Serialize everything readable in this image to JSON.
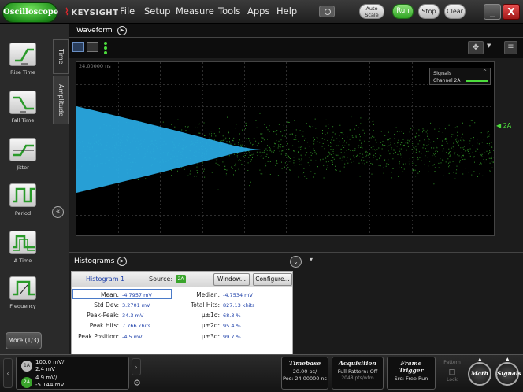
{
  "app": {
    "mode_button": "Oscilloscope",
    "brand": "KEYSIGHT"
  },
  "menu": [
    "File",
    "Setup",
    "Measure",
    "Tools",
    "Apps",
    "Help"
  ],
  "toolbar": {
    "auto_scale": "Auto Scale",
    "run": "Run",
    "stop": "Stop",
    "clear": "Clear",
    "minimize": "_",
    "close": "X"
  },
  "left_panel": {
    "tabs": [
      "Time",
      "Amplitude"
    ],
    "measurements": [
      "Rise Time",
      "Fall Time",
      "Jitter",
      "Period",
      "Δ Time",
      "Frequency"
    ],
    "more": "More (1/3)"
  },
  "waveform": {
    "title": "Waveform",
    "timestamp": "24.00000 ns",
    "signals_title": "Signals",
    "signals_channel": "Channel 2A",
    "channel_marker": "2A"
  },
  "histograms": {
    "title": "Histograms",
    "name": "Histogram 1",
    "source_label": "Source:",
    "source": "2A",
    "window_btn": "Window...",
    "configure_btn": "Configure...",
    "stats_left": [
      {
        "label": "Mean:",
        "value": "-4.7957 mV"
      },
      {
        "label": "Std Dev:",
        "value": "3.2701 mV"
      },
      {
        "label": "Peak-Peak:",
        "value": "34.3 mV"
      },
      {
        "label": "Peak Hits:",
        "value": "7.766 khits"
      },
      {
        "label": "Peak Position:",
        "value": "-4.5 mV"
      }
    ],
    "stats_right": [
      {
        "label": "Median:",
        "value": "-4.7534 mV"
      },
      {
        "label": "Total Hits:",
        "value": "827.13 khits"
      },
      {
        "label": "μ±1σ:",
        "value": "68.3 %"
      },
      {
        "label": "μ±2σ:",
        "value": "95.4 %"
      },
      {
        "label": "μ±3σ:",
        "value": "99.7 %"
      }
    ]
  },
  "bottom": {
    "ch1": {
      "badge": "1A",
      "scale": "100.0 mV/",
      "offset": "2.4 mV"
    },
    "ch2": {
      "badge": "2A",
      "scale": "4.9 mV/",
      "offset": "-5.144 mV"
    },
    "timebase": {
      "title": "Timebase",
      "line1": "20.00 ps/",
      "line2": "Pos: 24.00000 ns"
    },
    "acquisition": {
      "title": "Acquisition",
      "line1": "Full Pattern: Off",
      "line2": "2048 pts/wfm"
    },
    "trigger": {
      "title": "Frame Trigger",
      "line1": "Src: Free Run"
    },
    "pattern": {
      "title": "Pattern",
      "lock": "Lock"
    },
    "math": "Math",
    "signals": "Signals"
  },
  "colors": {
    "accent_green": "#4cdc3c",
    "waveform_blue": "#29a8e0",
    "link_blue": "#1a3da8"
  }
}
